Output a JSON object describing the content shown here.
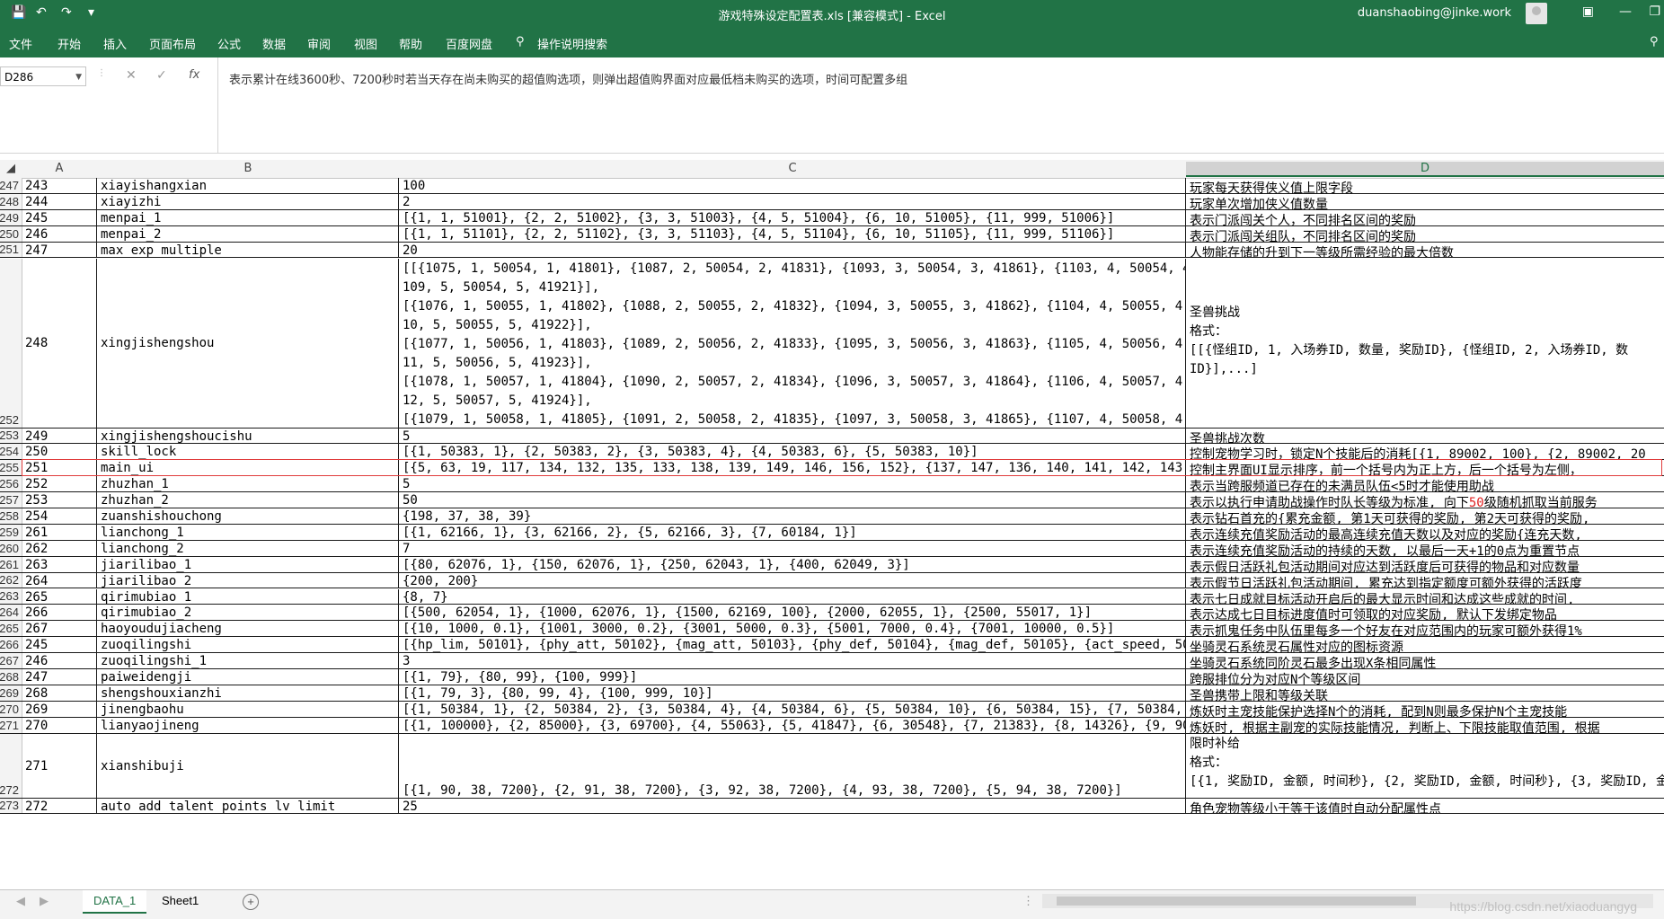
{
  "window": {
    "title": "游戏特殊设定配置表.xls  [兼容模式]  -  Excel",
    "user": "duanshaobing@jinke.work"
  },
  "menu": [
    "文件",
    "开始",
    "插入",
    "页面布局",
    "公式",
    "数据",
    "审阅",
    "视图",
    "帮助",
    "百度网盘",
    "操作说明搜索"
  ],
  "formula_bar": {
    "name_box": "D286",
    "fx": "fx",
    "content": "表示累计在线3600秒、7200秒时若当天存在尚未购买的超值购选项，则弹出超值购界面对应最低档未购买的选项，时间可配置多组"
  },
  "columns": [
    "A",
    "B",
    "C",
    "D"
  ],
  "rows": [
    {
      "rn": "247",
      "a": "243",
      "b": "xiayishangxian",
      "c": "100",
      "d": "玩家每天获得侠义值上限字段"
    },
    {
      "rn": "248",
      "a": "244",
      "b": "xiayizhi",
      "c": "2",
      "d": "玩家单次增加侠义值数量"
    },
    {
      "rn": "249",
      "a": "245",
      "b": "menpai_1",
      "c": "[{1, 1, 51001}, {2, 2, 51002}, {3, 3, 51003}, {4, 5, 51004}, {6, 10, 51005}, {11, 999, 51006}]",
      "d": "表示门派闯关个人，不同排名区间的奖励"
    },
    {
      "rn": "250",
      "a": "246",
      "b": "menpai_2",
      "c": "[{1, 1, 51101}, {2, 2, 51102}, {3, 3, 51103}, {4, 5, 51104}, {6, 10, 51105}, {11, 999, 51106}]",
      "d": "表示门派闯关组队，不同排名区间的奖励"
    },
    {
      "rn": "251",
      "a": "247",
      "b": "max_exp_multiple",
      "c": "20",
      "d": "人物能存储的升到下一等级所需经验的最大倍数"
    },
    {
      "rn": "252",
      "a": "248",
      "b": "xingjishengshou",
      "tall": true,
      "c_lines": [
        "[[{1075, 1, 50054, 1, 41801}, {1087, 2, 50054, 2, 41831}, {1093, 3, 50054, 3, 41861}, {1103, 4, 50054, 4, 41891}, {1",
        "109, 5, 50054, 5, 41921}],",
        "[{1076, 1, 50055, 1, 41802}, {1088, 2, 50055, 2, 41832}, {1094, 3, 50055, 3, 41862}, {1104, 4, 50055, 4, 41892}, {11",
        "10, 5, 50055, 5, 41922}],",
        "[{1077, 1, 50056, 1, 41803}, {1089, 2, 50056, 2, 41833}, {1095, 3, 50056, 3, 41863}, {1105, 4, 50056, 4, 41893}, {11",
        "11, 5, 50056, 5, 41923}],",
        "[{1078, 1, 50057, 1, 41804}, {1090, 2, 50057, 2, 41834}, {1096, 3, 50057, 3, 41864}, {1106, 4, 50057, 4, 41894}, {11",
        "12, 5, 50057, 5, 41924}],",
        "[{1079, 1, 50058, 1, 41805}, {1091, 2, 50058, 2, 41835}, {1097, 3, 50058, 3, 41865}, {1107, 4, 50058, 4, 41895}, {11",
        "13, 5, 50058, 5, 41925}]]"
      ],
      "d_lines": [
        "圣兽挑战",
        "格式：",
        "[[{怪组ID, 1, 入场券ID, 数量, 奖励ID}, {怪组ID, 2, 入场券ID, 数",
        "ID}],...]"
      ]
    },
    {
      "rn": "253",
      "a": "249",
      "b": "xingjishengshoucishu",
      "c": "5",
      "d": "圣兽挑战次数"
    },
    {
      "rn": "254",
      "a": "250",
      "b": "skill_lock",
      "c": "[{1, 50383, 1}, {2, 50383, 2}, {3, 50383, 4}, {4, 50383, 6}, {5, 50383, 10}]",
      "d": "控制宠物学习时，锁定N个技能后的消耗[{1, 89002, 100}, {2, 89002, 20"
    },
    {
      "rn": "255",
      "a": "251",
      "b": "main_ui",
      "c": "[{5, 63, 19, 117, 134, 132, 135, 133, 138, 139, 149, 146, 156, 152}, {137, 147, 136, 140, 141, 142, 143, 144, 148, 153, 1",
      "d": "控制主界面UI显示排序，前一个括号内为正上方，后一个括号为左侧，",
      "selected": true
    },
    {
      "rn": "256",
      "a": "252",
      "b": "zhuzhan_1",
      "c": "5",
      "d": "表示当跨服频道已存在的未满员队伍<5时才能使用助战"
    },
    {
      "rn": "257",
      "a": "253",
      "b": "zhuzhan_2",
      "c": "50",
      "d_pre": "表示以执行申请助战操作时队长等级为标准, 向下",
      "d_red": "50",
      "d_post": "级随机抓取当前服务"
    },
    {
      "rn": "258",
      "a": "254",
      "b": "zuanshishouchong",
      "c": "{198,  37,  38,  39}",
      "d": "表示钻石首充的{累充金额, 第1天可获得的奖励, 第2天可获得的奖励,"
    },
    {
      "rn": "259",
      "a": "261",
      "b": "lianchong_1",
      "c": "[{1, 62166, 1}, {3, 62166, 2}, {5, 62166, 3}, {7, 60184, 1}]",
      "d": "表示连续充值奖励活动的最高连续充值天数以及对应的奖励{连充天数,"
    },
    {
      "rn": "260",
      "a": "262",
      "b": "lianchong_2",
      "c": "7",
      "d": "表示连续充值奖励活动的持续的天数, 以最后一天+1的0点为重置节点"
    },
    {
      "rn": "261",
      "a": "263",
      "b": "jiarilibao_1",
      "c": "[{80, 62076, 1}, {150, 62076, 1}, {250, 62043, 1}, {400, 62049, 3}]",
      "d": "表示假日活跃礼包活动期间对应达到活跃度后可获得的物品和对应数量"
    },
    {
      "rn": "262",
      "a": "264",
      "b": "jiarilibao_2",
      "c": "{200,  200}",
      "d": "表示假节日活跃礼包活动期间, 累充达到指定额度可额外获得的活跃度"
    },
    {
      "rn": "263",
      "a": "265",
      "b": "qirimubiao_1",
      "c": "{8,  7}",
      "d": "表示七日成就目标活动开启后的最大显示时间和达成这些成就的时间,"
    },
    {
      "rn": "264",
      "a": "266",
      "b": "qirimubiao_2",
      "c": "[{500, 62054, 1}, {1000, 62076, 1}, {1500, 62169, 100}, {2000, 62055, 1}, {2500, 55017, 1}]",
      "d": "表示达成七日目标进度值时可领取的对应奖励, 默认下发绑定物品"
    },
    {
      "rn": "265",
      "a": "267",
      "b": "haoyoudujiacheng",
      "c": "[{10,  1000,  0.1}, {1001,  3000,  0.2}, {3001,  5000,  0.3}, {5001,  7000,  0.4}, {7001,  10000,  0.5}]",
      "d": "表示抓鬼任务中队伍里每多一个好友在对应范围内的玩家可额外获得1%"
    },
    {
      "rn": "266",
      "a": "245",
      "b": "zuoqilingshi",
      "c": "[{hp_lim, 50101}, {phy_att, 50102}, {mag_att, 50103}, {phy_def, 50104}, {mag_def, 50105}, {act_speed, 50106}",
      "d": "坐骑灵石系统灵石属性对应的图标资源"
    },
    {
      "rn": "267",
      "a": "246",
      "b": "zuoqilingshi_1",
      "c": "3",
      "d": "坐骑灵石系统同阶灵石最多出现X条相同属性"
    },
    {
      "rn": "268",
      "a": "247",
      "b": "paiweidengji",
      "c": "[{1,  79}, {80,  99}, {100,  999}]",
      "d": "跨服排位分为对应N个等级区间"
    },
    {
      "rn": "269",
      "a": "268",
      "b": "shengshouxianzhi",
      "c": "[{1, 79, 3}, {80, 99, 4}, {100, 999, 10}]",
      "d": "圣兽携带上限和等级关联"
    },
    {
      "rn": "270",
      "a": "269",
      "b": "jinengbaohu",
      "c": "[{1, 50384, 1}, {2, 50384, 2}, {3, 50384, 4}, {4, 50384, 6}, {5, 50384, 10}, {6, 50384, 15}, {7, 50384, 20}, {8, 50384,",
      "d": "炼妖时主宠技能保护选择N个的消耗, 配到N则最多保护N个主宠技能"
    },
    {
      "rn": "271",
      "a": "270",
      "b": "lianyaojineng",
      "c": "[{1, 100000}, {2, 85000}, {3, 69700}, {4, 55063}, {5, 41847}, {6, 30548}, {7, 21383}, {8, 14326}, {9, 9025}, {10, 52",
      "d": "炼妖时, 根据主副宠的实际技能情况, 判断上、下限技能取值范围, 根据"
    },
    {
      "rn": "272",
      "a": "271",
      "b": "xianshibuji",
      "mid": true,
      "c": "[{1, 90, 38, 7200}, {2, 91, 38, 7200}, {3, 92, 38, 7200}, {4, 93, 38, 7200}, {5, 94, 38, 7200}]",
      "d_lines": [
        "限时补给",
        "格式：",
        "[{1, 奖励ID, 金额, 时间秒}, {2, 奖励ID, 金额, 时间秒}, {3, 奖励ID, 金额"
      ]
    },
    {
      "rn": "273",
      "a": "272",
      "b": "auto_add_talent_points_lv_limit",
      "c": "25",
      "d": "角色宠物等级小于等于该值时自动分配属性点"
    }
  ],
  "sheets": [
    "DATA_1",
    "Sheet1"
  ],
  "watermark": "https://blog.csdn.net/xiaoduangyg"
}
